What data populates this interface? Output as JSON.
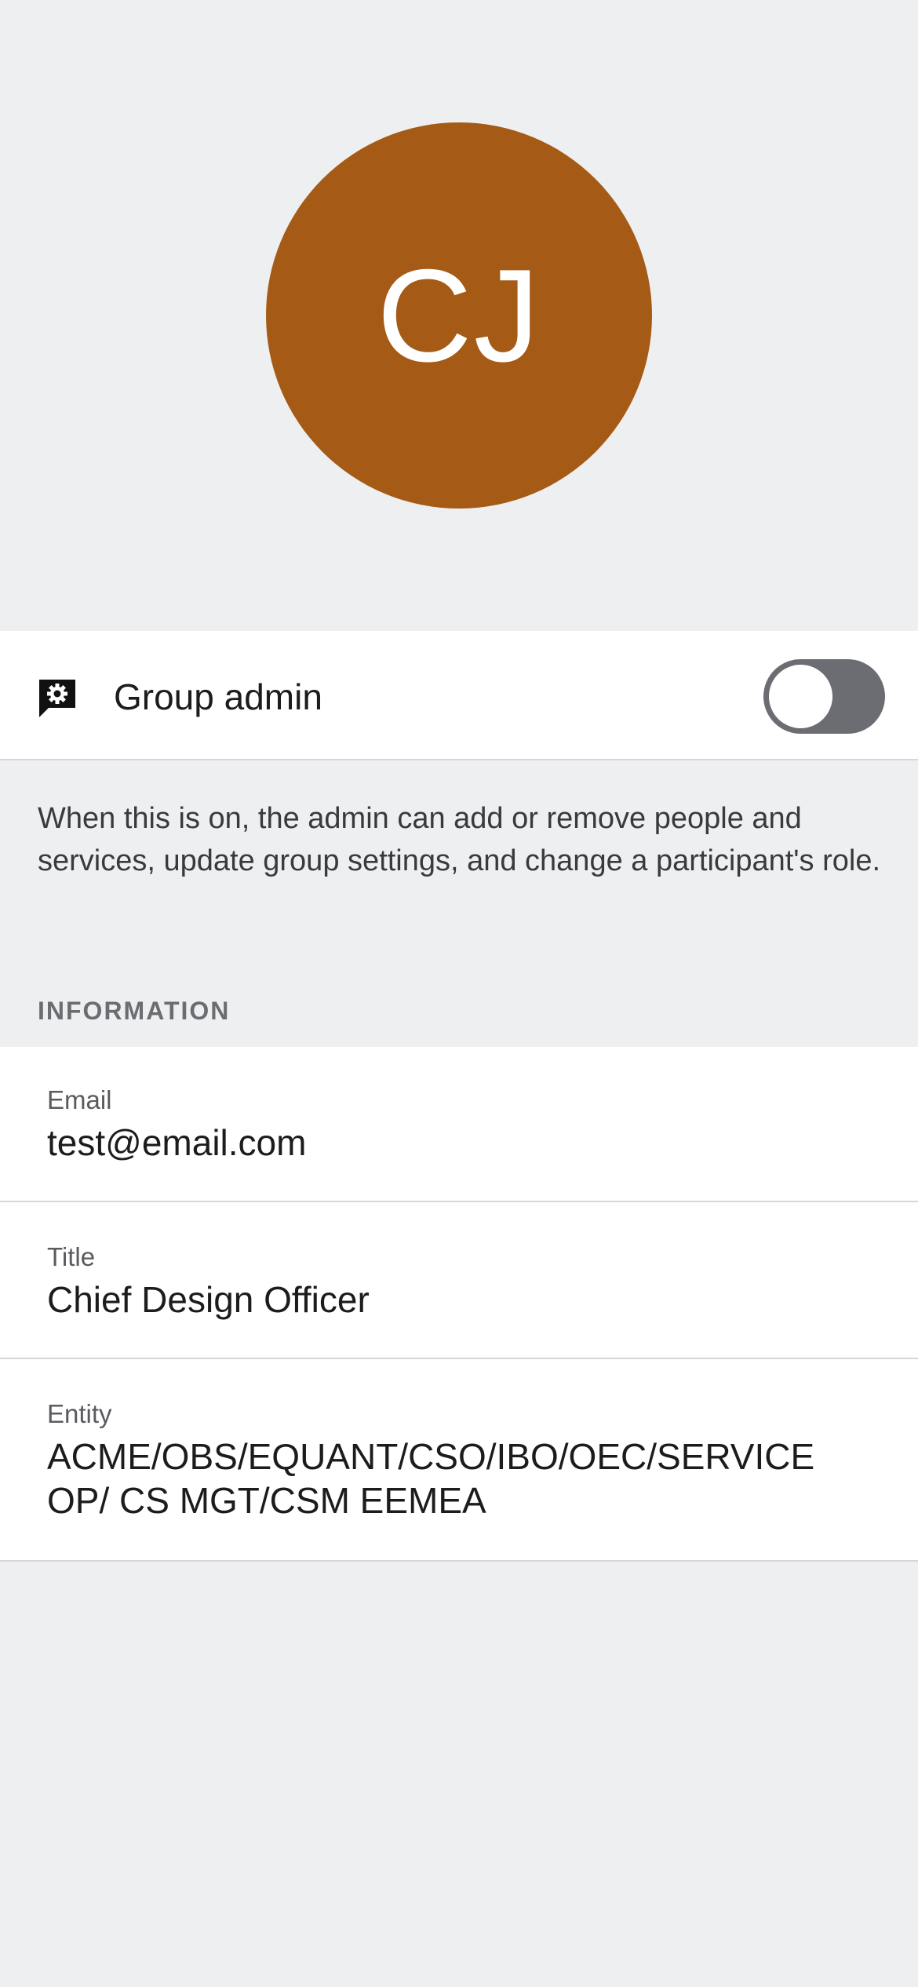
{
  "profile": {
    "initials": "CJ",
    "avatar_color": "#a55a16"
  },
  "group_admin": {
    "label": "Group admin",
    "icon": "admin-badge-icon",
    "enabled": false,
    "toggle_track_color": "#6b6d73",
    "description": "When this is on, the admin can add or remove people and services, update group settings, and change a participant's role."
  },
  "information": {
    "header": "INFORMATION",
    "email": {
      "label": "Email",
      "value": "test@email.com"
    },
    "title": {
      "label": "Title",
      "value": "Chief Design Officer"
    },
    "entity": {
      "label": "Entity",
      "value": "ACME/OBS/EQUANT/CSO/IBO/OEC/SERVICE OP/ CS MGT/CSM EEMEA"
    }
  }
}
